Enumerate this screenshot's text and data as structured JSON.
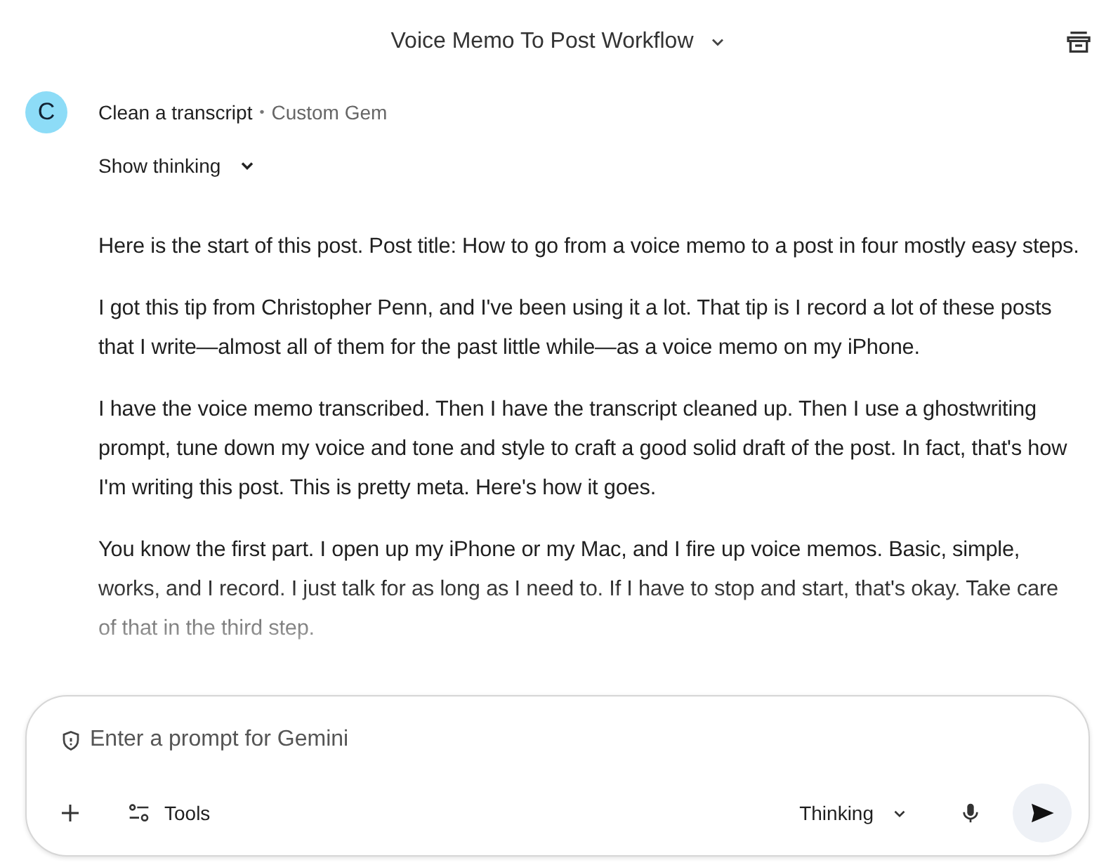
{
  "header": {
    "title": "Voice Memo To Post Workflow"
  },
  "gem": {
    "avatar": "C",
    "name": "Clean a transcript",
    "separator": "•",
    "kind_label": "Custom Gem"
  },
  "show_thinking": {
    "label": "Show thinking",
    "expanded": false
  },
  "paragraphs": [
    "Here is the start of this post. Post title: How to go from a voice memo to a post in four mostly easy steps.",
    "I got this tip from Christopher Penn, and I've been using it a lot. That tip is I record a lot of these posts that I write—almost all of them for the past little while—as a voice memo on my iPhone.",
    "I have the voice memo transcribed. Then I have the transcript cleaned up. Then I use a ghostwriting prompt, tune down my voice and tone and style to craft a good solid draft of the post. In fact, that's how I'm writing this post. This is pretty meta. Here's how it goes.",
    "You know the first part. I open up my iPhone or my Mac, and I fire up voice memos. Basic, simple, works, and I record. I just talk for as long as I need to. If I have to stop and start, that's okay. Take care of that in the third step."
  ],
  "composer": {
    "placeholder": "Enter a prompt for Gemini",
    "tools_label": "Tools",
    "mode_label": "Thinking"
  }
}
